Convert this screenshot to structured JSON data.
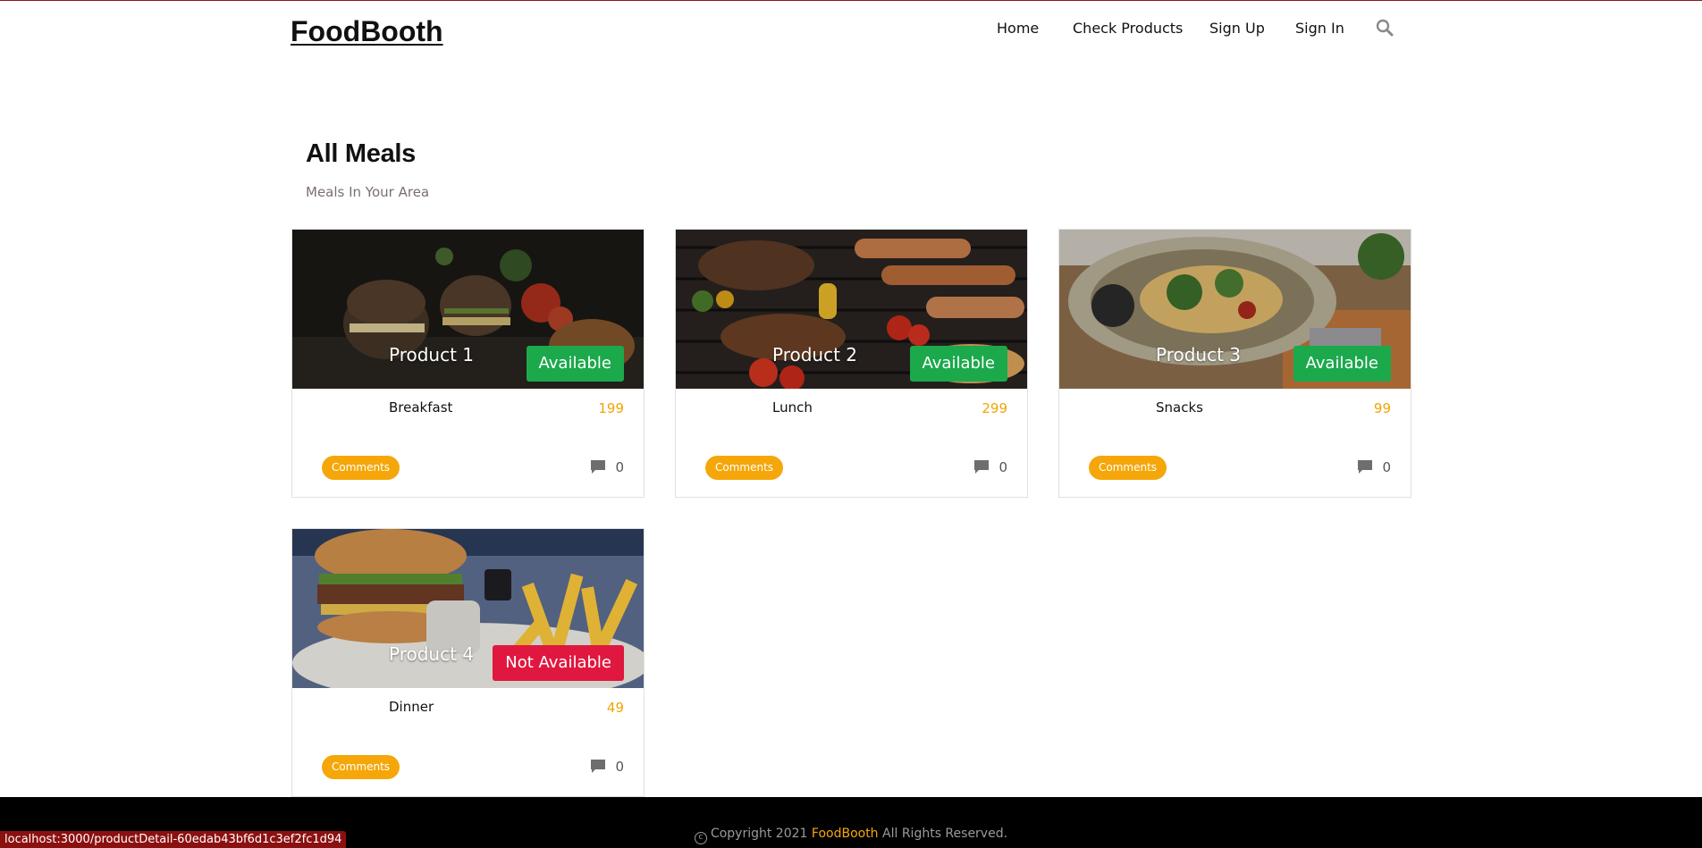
{
  "header": {
    "logo": "FoodBooth",
    "nav": [
      "Home",
      "Check Products",
      "Sign Up",
      "Sign In"
    ],
    "search_icon": "search-icon"
  },
  "main": {
    "title": "All Meals",
    "subtitle": "Meals In Your Area",
    "cards": [
      {
        "name": "Product 1",
        "status": "Available",
        "category": "Breakfast",
        "price": "199",
        "comments_label": "Comments",
        "comment_count": "0",
        "image": "burgers-on-dark-background"
      },
      {
        "name": "Product 2",
        "status": "Available",
        "category": "Lunch",
        "price": "299",
        "comments_label": "Comments",
        "comment_count": "0",
        "image": "grilled-meats-and-sausages"
      },
      {
        "name": "Product 3",
        "status": "Available",
        "category": "Snacks",
        "price": "99",
        "comments_label": "Comments",
        "comment_count": "0",
        "image": "pasta-bowl"
      },
      {
        "name": "Product 4",
        "status": "Not Available",
        "category": "Dinner",
        "price": "49",
        "comments_label": "Comments",
        "comment_count": "0",
        "image": "burger-and-fries"
      }
    ]
  },
  "footer": {
    "copyright_prefix": "Copyright 2021",
    "brand": "FoodBooth",
    "suffix": "All Rights Reserved."
  },
  "status_bar_url": "localhost:3000/productDetail-60edab43bf6d1c3ef2fc1d94",
  "colors": {
    "accent": "#f5a70a",
    "available": "#1ba94c",
    "not_available": "#e0173f",
    "footer_bg": "#000000"
  }
}
